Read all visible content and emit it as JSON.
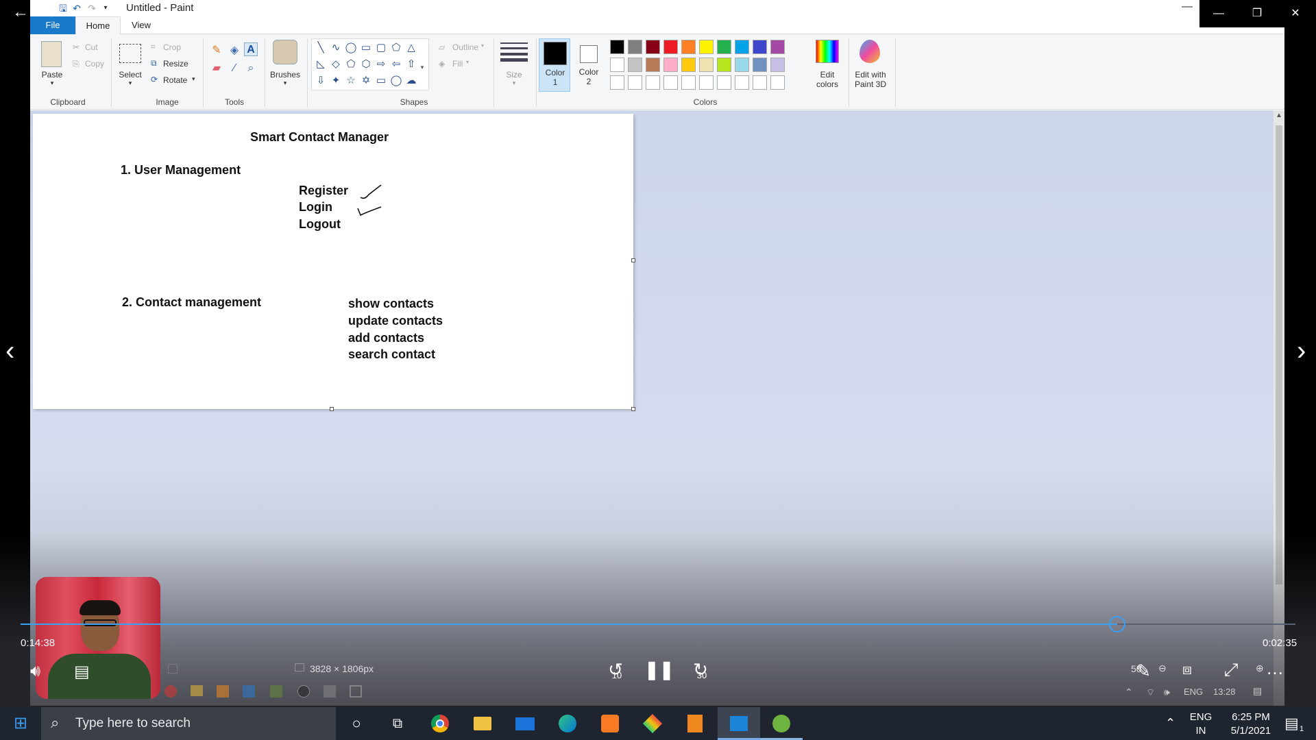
{
  "window": {
    "title": "Untitled - Paint",
    "minimize_glyph": "—",
    "restore_glyph": "❐",
    "close_glyph": "✕"
  },
  "tabs": [
    "File",
    "Home",
    "View"
  ],
  "ribbon": {
    "clipboard": {
      "paste": "Paste",
      "cut": "Cut",
      "copy": "Copy",
      "group": "Clipboard"
    },
    "image": {
      "select": "Select",
      "crop": "Crop",
      "resize": "Resize",
      "rotate": "Rotate",
      "group": "Image"
    },
    "tools": {
      "group": "Tools"
    },
    "brushes": {
      "label": "Brushes"
    },
    "shapes": {
      "outline": "Outline",
      "fill": "Fill",
      "group": "Shapes"
    },
    "size": {
      "label": "Size"
    },
    "color1": {
      "line1": "Color",
      "line2": "1"
    },
    "color2": {
      "line1": "Color",
      "line2": "2"
    },
    "colors": {
      "group": "Colors"
    },
    "edit_colors": {
      "line1": "Edit",
      "line2": "colors"
    },
    "paint3d": {
      "line1": "Edit with",
      "line2": "Paint 3D"
    },
    "palette_row1": [
      "#000000",
      "#7f7f7f",
      "#880015",
      "#ed1c24",
      "#ff7f27",
      "#fff200",
      "#22b14c",
      "#00a2e8",
      "#3f48cc",
      "#a349a4"
    ],
    "palette_row2": [
      "#ffffff",
      "#c3c3c3",
      "#b97a57",
      "#ffaec9",
      "#ffc90e",
      "#efe4b0",
      "#b5e61d",
      "#99d9ea",
      "#7092be",
      "#c8bfe7"
    ],
    "palette_row3": [
      "#ffffff",
      "#ffffff",
      "#ffffff",
      "#ffffff",
      "#ffffff",
      "#ffffff",
      "#ffffff",
      "#ffffff",
      "#ffffff",
      "#ffffff"
    ]
  },
  "canvas": {
    "title": "Smart Contact Manager",
    "section1": "1. User Management",
    "register": "Register",
    "login": "Login",
    "logout": "Logout",
    "section2": "2. Contact management",
    "show_contacts": "show contacts",
    "update_contacts": "update contacts",
    "add_contacts": "add contacts",
    "search_contact": "search contact"
  },
  "status": {
    "dimensions": "3828 × 1806px"
  },
  "video": {
    "elapsed": "0:14:38",
    "remaining": "0:02:35",
    "progress_fraction": 0.86,
    "rewind_label": "10",
    "forward_label": "30",
    "zoom_partial": "50"
  },
  "inner_tray": {
    "lang": "ENG",
    "time": "13:28"
  },
  "taskbar": {
    "search_placeholder": "Type here to search",
    "lang_line1": "ENG",
    "lang_line2": "IN",
    "time": "6:25 PM",
    "date": "5/1/2021",
    "notification_count": "1"
  }
}
